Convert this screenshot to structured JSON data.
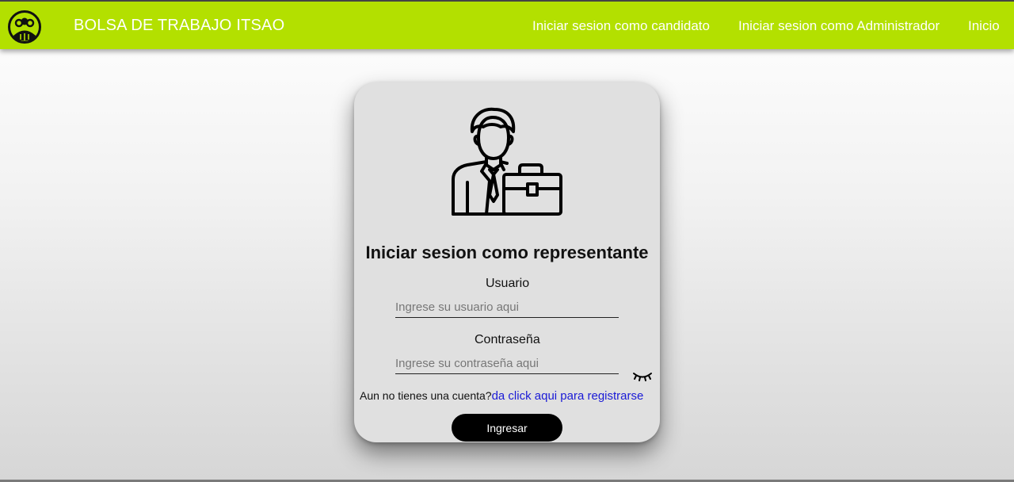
{
  "header": {
    "brand": "BOLSA DE TRABAJO ITSAO",
    "nav": {
      "candidato": "Iniciar sesion como candidato",
      "admin": "Iniciar sesion como Administrador",
      "inicio": "Inicio"
    },
    "logo_icon": "people-circle-logo-icon",
    "accent_color": "#b3e000"
  },
  "login": {
    "avatar_icon": "businessman-briefcase-icon",
    "title": "Iniciar sesion como representante",
    "user_label": "Usuario",
    "user_placeholder": "Ingrese su usuario aqui",
    "pass_label": "Contraseña",
    "pass_placeholder": "Ingrese su contraseña aqui",
    "toggle_icon": "eye-closed-icon",
    "register_prompt": "Aun no tienes una cuenta?",
    "register_link": "da click aqui para registrarse",
    "submit_label": "Ingresar",
    "link_color": "#1a1ad6"
  }
}
